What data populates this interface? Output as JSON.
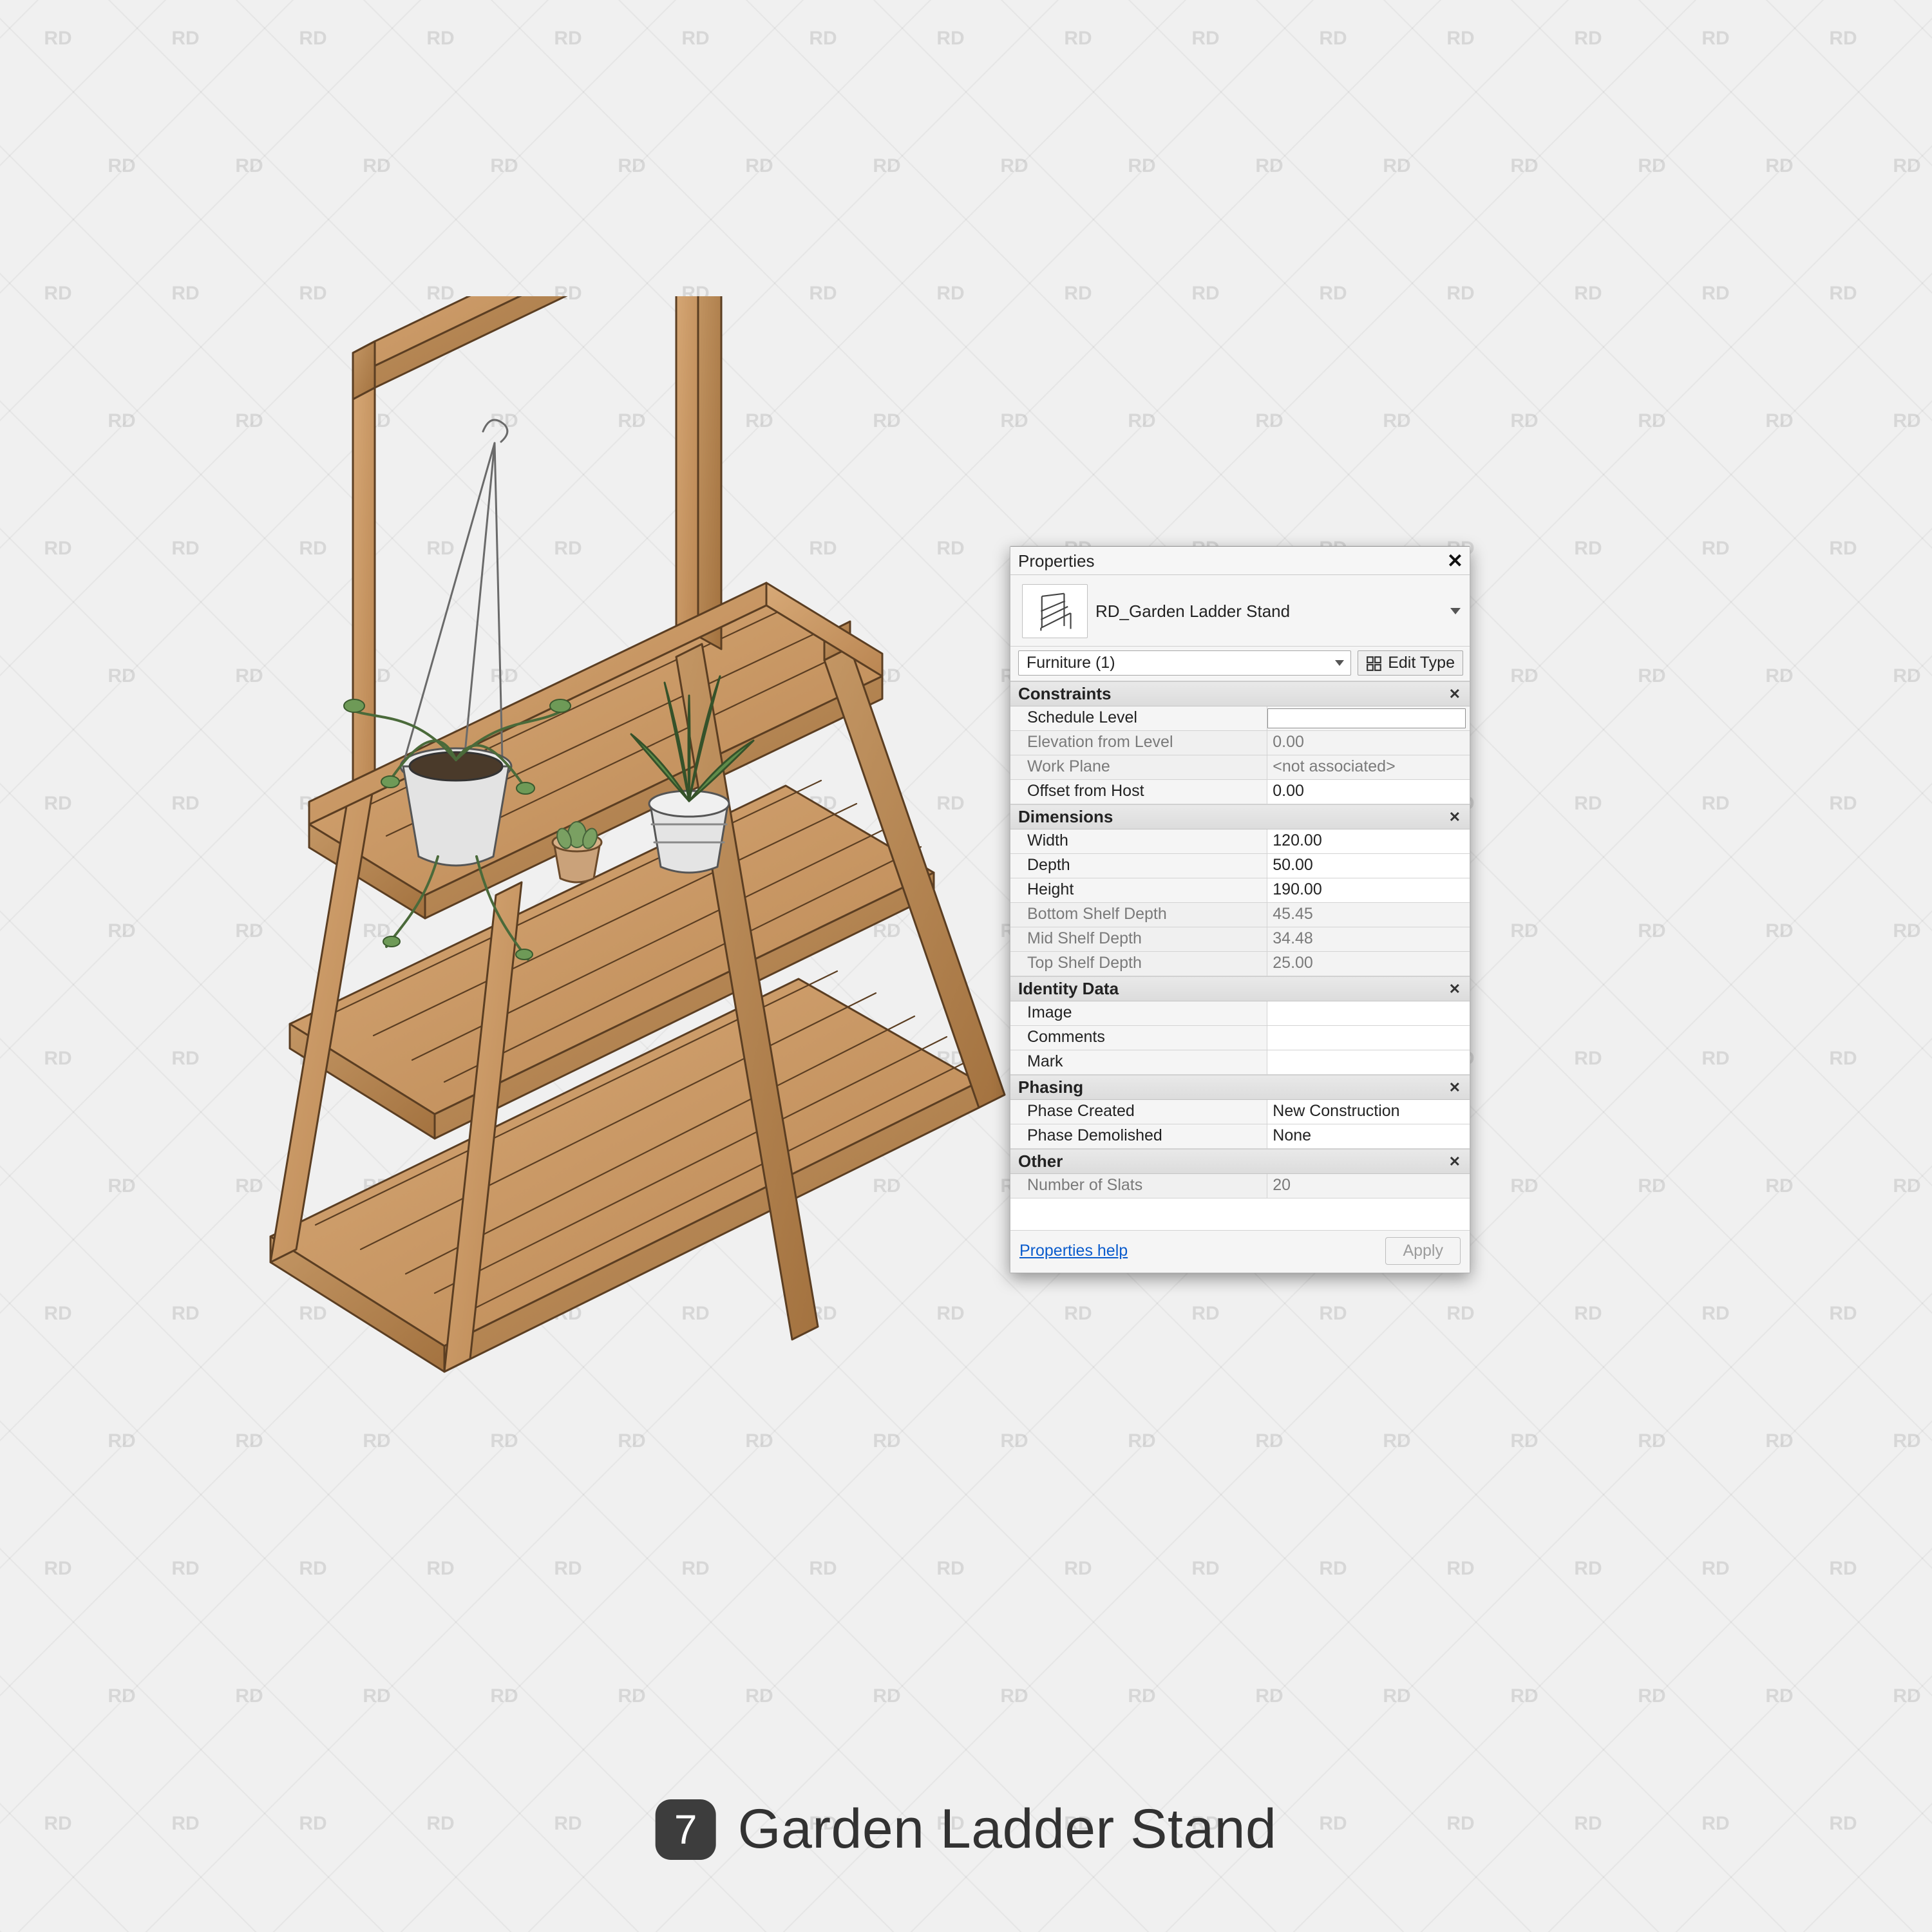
{
  "page": {
    "caption_number": "7",
    "caption_text": "Garden Ladder Stand",
    "watermark_text": "RD"
  },
  "panel": {
    "title": "Properties",
    "type_name": "RD_Garden Ladder Stand",
    "selector_label": "Furniture (1)",
    "edit_type_label": "Edit Type",
    "help_link_label": "Properties help",
    "apply_label": "Apply",
    "sections": {
      "constraints": {
        "title": "Constraints",
        "schedule_level": {
          "label": "Schedule Level",
          "value": ""
        },
        "elevation_from_level": {
          "label": "Elevation from Level",
          "value": "0.00"
        },
        "work_plane": {
          "label": "Work Plane",
          "value": "<not associated>"
        },
        "offset_from_host": {
          "label": "Offset from Host",
          "value": "0.00"
        }
      },
      "dimensions": {
        "title": "Dimensions",
        "width": {
          "label": "Width",
          "value": "120.00"
        },
        "depth": {
          "label": "Depth",
          "value": "50.00"
        },
        "height": {
          "label": "Height",
          "value": "190.00"
        },
        "bottom_shelf_depth": {
          "label": "Bottom Shelf Depth",
          "value": "45.45"
        },
        "mid_shelf_depth": {
          "label": "Mid Shelf Depth",
          "value": "34.48"
        },
        "top_shelf_depth": {
          "label": "Top Shelf Depth",
          "value": "25.00"
        }
      },
      "identity": {
        "title": "Identity Data",
        "image": {
          "label": "Image",
          "value": ""
        },
        "comments": {
          "label": "Comments",
          "value": ""
        },
        "mark": {
          "label": "Mark",
          "value": ""
        }
      },
      "phasing": {
        "title": "Phasing",
        "phase_created": {
          "label": "Phase Created",
          "value": "New Construction"
        },
        "phase_demolished": {
          "label": "Phase Demolished",
          "value": "None"
        }
      },
      "other": {
        "title": "Other",
        "number_of_slats": {
          "label": "Number of Slats",
          "value": "20"
        }
      }
    }
  }
}
